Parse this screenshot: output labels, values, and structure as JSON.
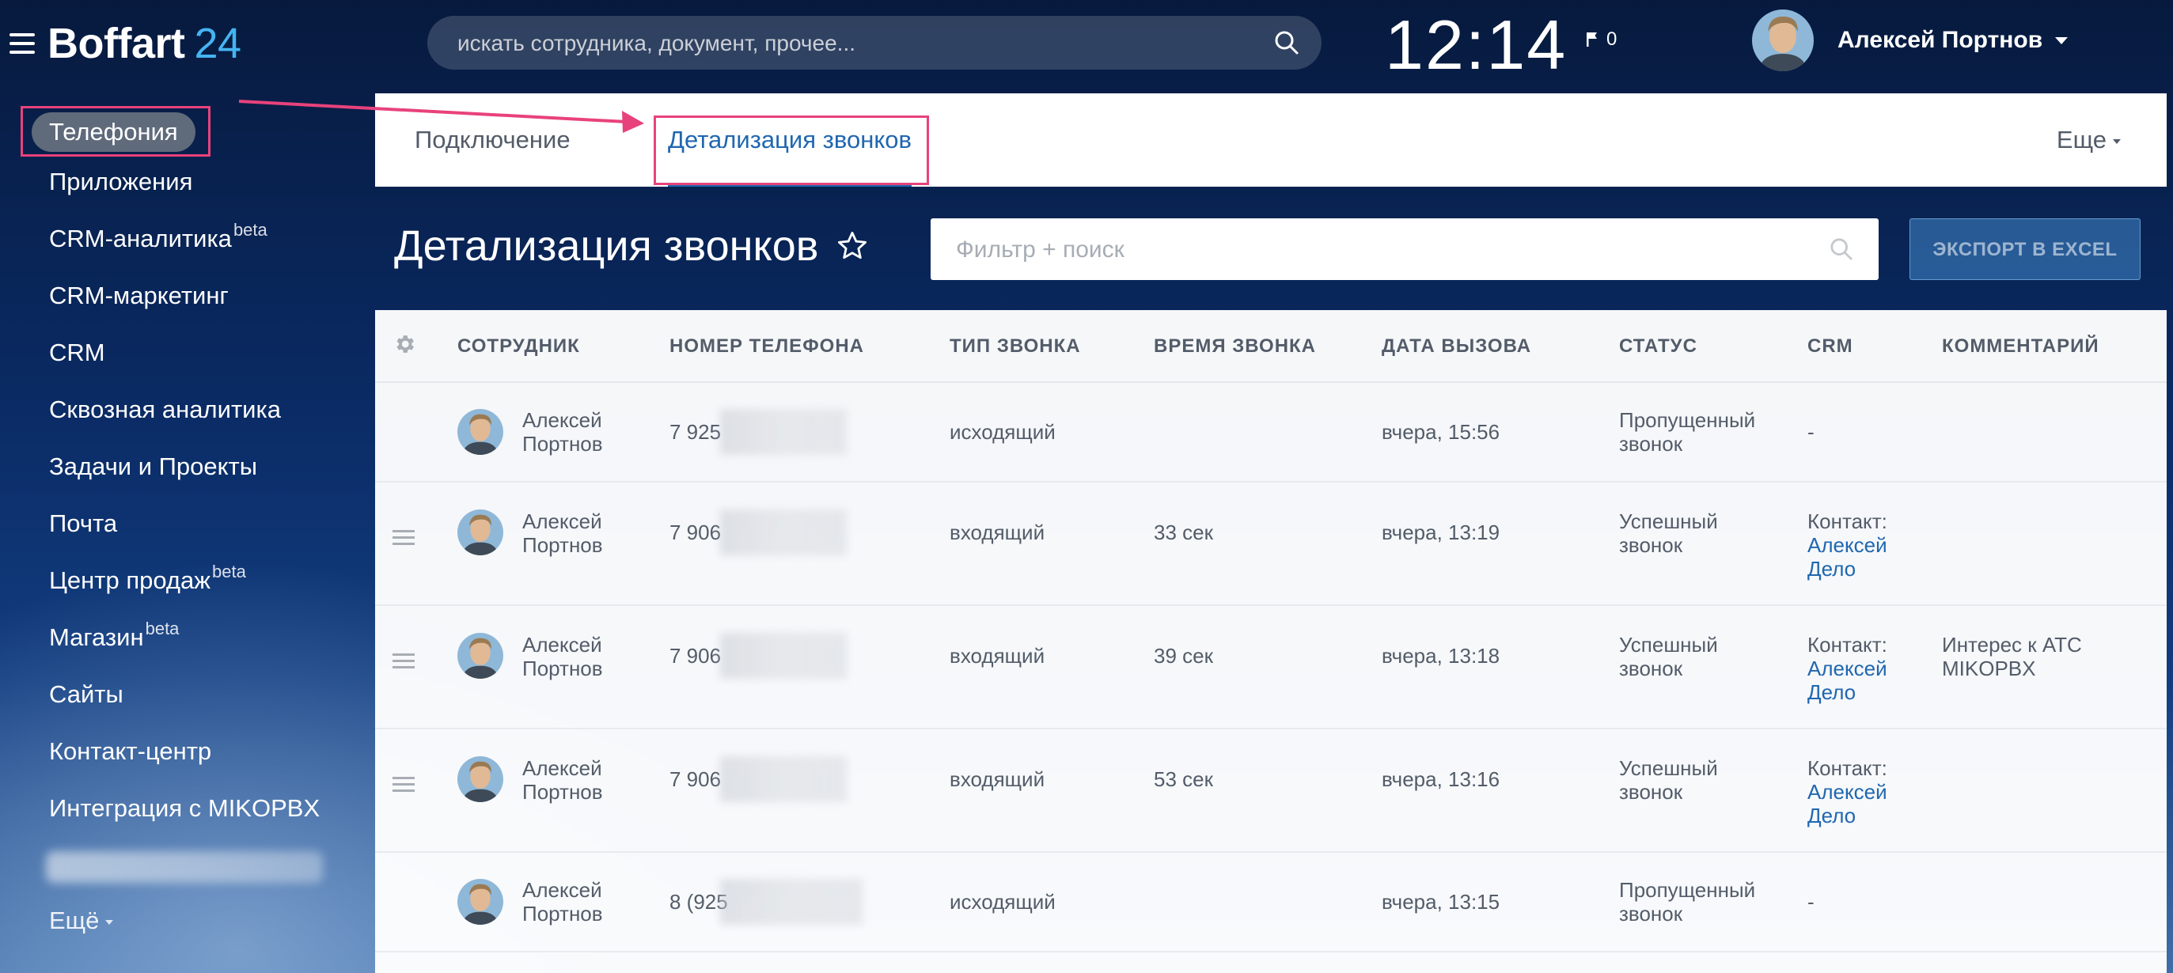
{
  "header": {
    "logo_brand": "Boffart",
    "logo_number": "24",
    "search_placeholder": "искать сотрудника, документ, прочее...",
    "clock": "12:14",
    "flag_count": "0",
    "user_name": "Алексей Портнов"
  },
  "sidebar": {
    "active_item": "Телефония",
    "items": [
      {
        "label": "Приложения",
        "sup": ""
      },
      {
        "label": "CRM-аналитика",
        "sup": "beta"
      },
      {
        "label": "CRM-маркетинг",
        "sup": ""
      },
      {
        "label": "CRM",
        "sup": ""
      },
      {
        "label": "Сквозная аналитика",
        "sup": ""
      },
      {
        "label": "Задачи и Проекты",
        "sup": ""
      },
      {
        "label": "Почта",
        "sup": ""
      },
      {
        "label": "Центр продаж",
        "sup": "beta"
      },
      {
        "label": "Магазин",
        "sup": "beta"
      },
      {
        "label": "Сайты",
        "sup": ""
      },
      {
        "label": "Контакт-центр",
        "sup": ""
      },
      {
        "label": "Интеграция с MIKOPBX",
        "sup": ""
      }
    ],
    "more_label": "Ещё"
  },
  "tabs": {
    "connection": "Подключение",
    "details": "Детализация звонков",
    "more": "Еще"
  },
  "page": {
    "title": "Детализация звонков",
    "filter_placeholder": "Фильтр + поиск",
    "export_label": "ЭКСПОРТ В EXCEL"
  },
  "colors": {
    "accent_blue": "#2067b0",
    "highlight_pink": "#e8427c",
    "text_gray": "#535c69"
  },
  "table": {
    "columns": {
      "employee": "СОТРУДНИК",
      "phone": "НОМЕР ТЕЛЕФОНА",
      "type": "ТИП ЗВОНКА",
      "duration": "ВРЕМЯ ЗВОНКА",
      "date": "ДАТА ВЫЗОВА",
      "status": "СТАТУС",
      "crm": "CRM",
      "comment": "КОММЕНТАРИЙ"
    },
    "rows": [
      {
        "emp1": "Алексей",
        "emp2": "Портнов",
        "phone": "7 925",
        "type": "исходящий",
        "duration": "",
        "date": "вчера, 15:56",
        "status1": "Пропущенный",
        "status2": "звонок",
        "crm_label": "-",
        "crm_link1": "",
        "crm_link2": "",
        "comment1": "",
        "comment2": ""
      },
      {
        "emp1": "Алексей",
        "emp2": "Портнов",
        "phone": "7 906",
        "type": "входящий",
        "duration": "33 сек",
        "date": "вчера, 13:19",
        "status1": "Успешный",
        "status2": "звонок",
        "crm_label": "Контакт:",
        "crm_link1": "Алексей",
        "crm_link2": "Дело",
        "comment1": "",
        "comment2": ""
      },
      {
        "emp1": "Алексей",
        "emp2": "Портнов",
        "phone": "7 906",
        "type": "входящий",
        "duration": "39 сек",
        "date": "вчера, 13:18",
        "status1": "Успешный",
        "status2": "звонок",
        "crm_label": "Контакт:",
        "crm_link1": "Алексей",
        "crm_link2": "Дело",
        "comment1": "Интерес к АТС",
        "comment2": "MIKOPBX"
      },
      {
        "emp1": "Алексей",
        "emp2": "Портнов",
        "phone": "7 906",
        "type": "входящий",
        "duration": "53 сек",
        "date": "вчера, 13:16",
        "status1": "Успешный",
        "status2": "звонок",
        "crm_label": "Контакт:",
        "crm_link1": "Алексей",
        "crm_link2": "Дело",
        "comment1": "",
        "comment2": ""
      },
      {
        "emp1": "Алексей",
        "emp2": "Портнов",
        "phone": "8 (925",
        "type": "исходящий",
        "duration": "",
        "date": "вчера, 13:15",
        "status1": "Пропущенный",
        "status2": "звонок",
        "crm_label": "-",
        "crm_link1": "",
        "crm_link2": "",
        "comment1": "",
        "comment2": ""
      }
    ]
  }
}
